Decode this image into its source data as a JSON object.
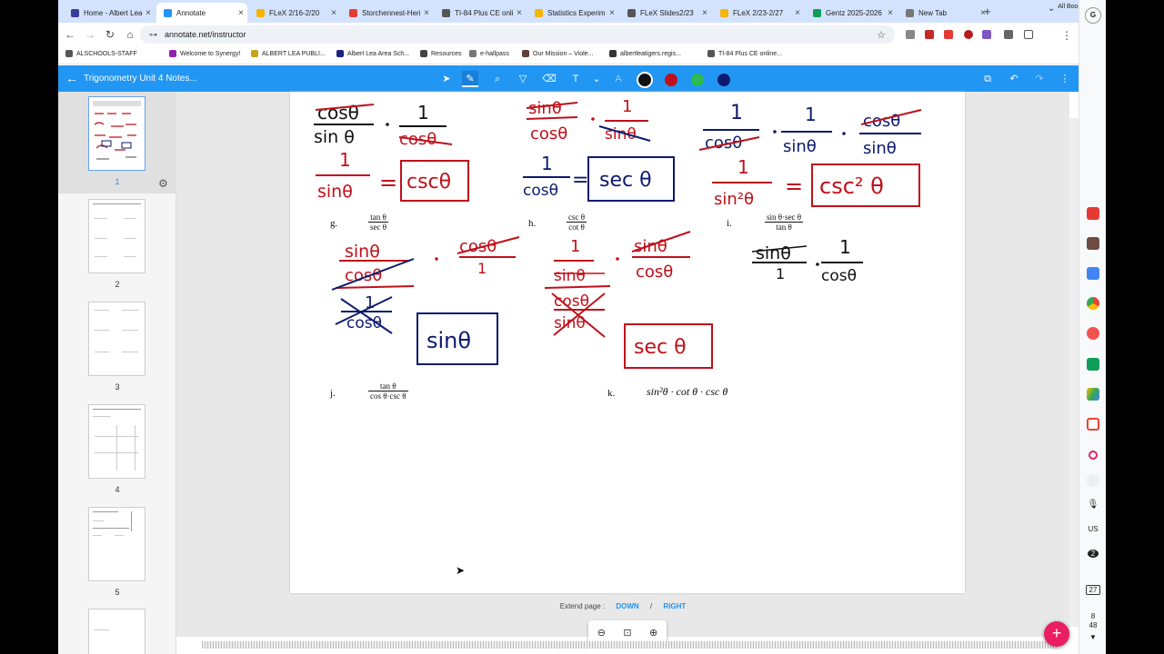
{
  "tabs": [
    {
      "title": "Home - Albert Lea",
      "color": "#3c3c9c",
      "active": false
    },
    {
      "title": "Annotate",
      "color": "#2196f3",
      "active": true
    },
    {
      "title": "FLeX 2/16-2/20",
      "color": "#f4b400",
      "active": false
    },
    {
      "title": "Storchennest-Heri",
      "color": "#e53935",
      "active": false
    },
    {
      "title": "TI-84 Plus CE onli",
      "color": "#555555",
      "active": false
    },
    {
      "title": "Statistics Experim",
      "color": "#f4b400",
      "active": false
    },
    {
      "title": "FLeX Slides2/23",
      "color": "#555555",
      "active": false
    },
    {
      "title": "FLeX 2/23-2/27",
      "color": "#f4b400",
      "active": false
    },
    {
      "title": "Gentz 2025-2026",
      "color": "#0f9d58",
      "active": false
    },
    {
      "title": "New Tab",
      "color": "#777777",
      "active": false
    }
  ],
  "address": {
    "url": "annotate.net/instructor"
  },
  "bookmarks": [
    {
      "label": "ALSCHOOLS-STAFF",
      "color": "#555"
    },
    {
      "label": "Welcome to Synergy!",
      "color": "#8e24aa"
    },
    {
      "label": "ALBERT LEA PUBLI...",
      "color": "#c8a21f"
    },
    {
      "label": "Albert Lea Area Sch...",
      "color": "#1a237e"
    },
    {
      "label": "Resources",
      "color": "#444"
    },
    {
      "label": "e-hallpass",
      "color": "#777"
    },
    {
      "label": "Our Mission – Viole...",
      "color": "#5d4037"
    },
    {
      "label": "albertleatigers.regis...",
      "color": "#333"
    },
    {
      "label": "TI-84 Plus CE online...",
      "color": "#555"
    }
  ],
  "all_bookmarks_label": "All Bookmarks",
  "app": {
    "doc_title": "Trigonometry Unit 4 Notes..."
  },
  "colors": {
    "black": "#111111",
    "red": "#c0101a",
    "green": "#2dbb4f",
    "navy": "#0d1a6e",
    "accent": "#2196f3"
  },
  "thumbnails": [
    "1",
    "2",
    "3",
    "4",
    "5"
  ],
  "worksheet": {
    "g": {
      "label": "g.",
      "num": "tan θ",
      "den": "sec θ"
    },
    "h": {
      "label": "h.",
      "num": "csc θ",
      "den": "cot θ"
    },
    "i": {
      "label": "i.",
      "num": "sin θ·sec θ",
      "den": "tan θ"
    },
    "j": {
      "label": "j.",
      "num": "tan θ",
      "den": "cos θ·csc θ"
    },
    "k": {
      "label": "k.",
      "expr": "sin²θ · cot θ · csc θ"
    }
  },
  "handwriting": {
    "row1_a_result": "cscθ",
    "row1_b_result": "sec θ",
    "row1_c_result": "csc² θ",
    "g_result": "sinθ",
    "h_result": "sec θ"
  },
  "extend": {
    "label": "Extend page :",
    "down": "DOWN",
    "sep": "/",
    "right": "RIGHT"
  },
  "shelf": {
    "region": "US",
    "badge": "2",
    "calendar": "27",
    "time_h": "8",
    "time_m": "48"
  }
}
